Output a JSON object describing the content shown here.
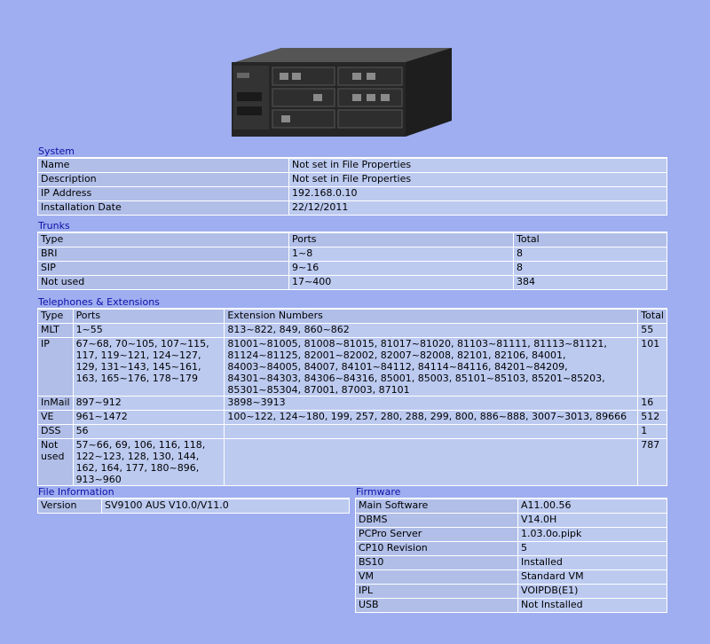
{
  "device_image": "pbx-chassis",
  "system": {
    "title": "System",
    "rows": [
      {
        "label": "Name",
        "value": "Not set in File Properties"
      },
      {
        "label": "Description",
        "value": "Not set in File Properties"
      },
      {
        "label": "IP Address",
        "value": "192.168.0.10"
      },
      {
        "label": "Installation Date",
        "value": "22/12/2011"
      }
    ]
  },
  "trunks": {
    "title": "Trunks",
    "headers": [
      "Type",
      "Ports",
      "Total"
    ],
    "rows": [
      [
        "BRI",
        "1~8",
        "8"
      ],
      [
        "SIP",
        "9~16",
        "8"
      ],
      [
        "Not used",
        "17~400",
        "384"
      ]
    ]
  },
  "telephones": {
    "title": "Telephones & Extensions",
    "headers": [
      "Type",
      "Ports",
      "Extension Numbers",
      "Total"
    ],
    "rows": [
      [
        "MLT",
        "1~55",
        "813~822, 849, 860~862",
        "55"
      ],
      [
        "IP",
        "67~68, 70~105, 107~115, 117, 119~121, 124~127, 129, 131~143, 145~161, 163, 165~176, 178~179",
        "81001~81005, 81008~81015, 81017~81020, 81103~81111, 81113~81121, 81124~81125, 82001~82002, 82007~82008, 82101, 82106, 84001, 84003~84005, 84007, 84101~84112, 84114~84116, 84201~84209, 84301~84303, 84306~84316, 85001, 85003, 85101~85103, 85201~85203, 85301~85304, 87001, 87003, 87101",
        "101"
      ],
      [
        "InMail",
        "897~912",
        "3898~3913",
        "16"
      ],
      [
        "VE",
        "961~1472",
        "100~122, 124~180, 199, 257, 280, 288, 299, 800, 886~888, 3007~3013, 89666",
        "512"
      ],
      [
        "DSS",
        "56",
        "",
        "1"
      ],
      [
        "Not used",
        "57~66, 69, 106, 116, 118, 122~123, 128, 130, 144, 162, 164, 177, 180~896, 913~960",
        "",
        "787"
      ]
    ]
  },
  "file_information": {
    "title": "File Information",
    "rows": [
      {
        "label": "Version",
        "value": "SV9100 AUS V10.0/V11.0"
      }
    ]
  },
  "firmware": {
    "title": "Firmware",
    "rows": [
      {
        "label": "Main Software",
        "value": "A11.00.56"
      },
      {
        "label": "DBMS",
        "value": "V14.0H"
      },
      {
        "label": "PCPro Server",
        "value": "1.03.0o.pipk"
      },
      {
        "label": "CP10 Revision",
        "value": "5"
      },
      {
        "label": "BS10",
        "value": "Installed"
      },
      {
        "label": "VM",
        "value": "Standard VM"
      },
      {
        "label": "IPL",
        "value": "VOIPDB(E1)"
      },
      {
        "label": "USB",
        "value": "Not Installed"
      }
    ]
  }
}
